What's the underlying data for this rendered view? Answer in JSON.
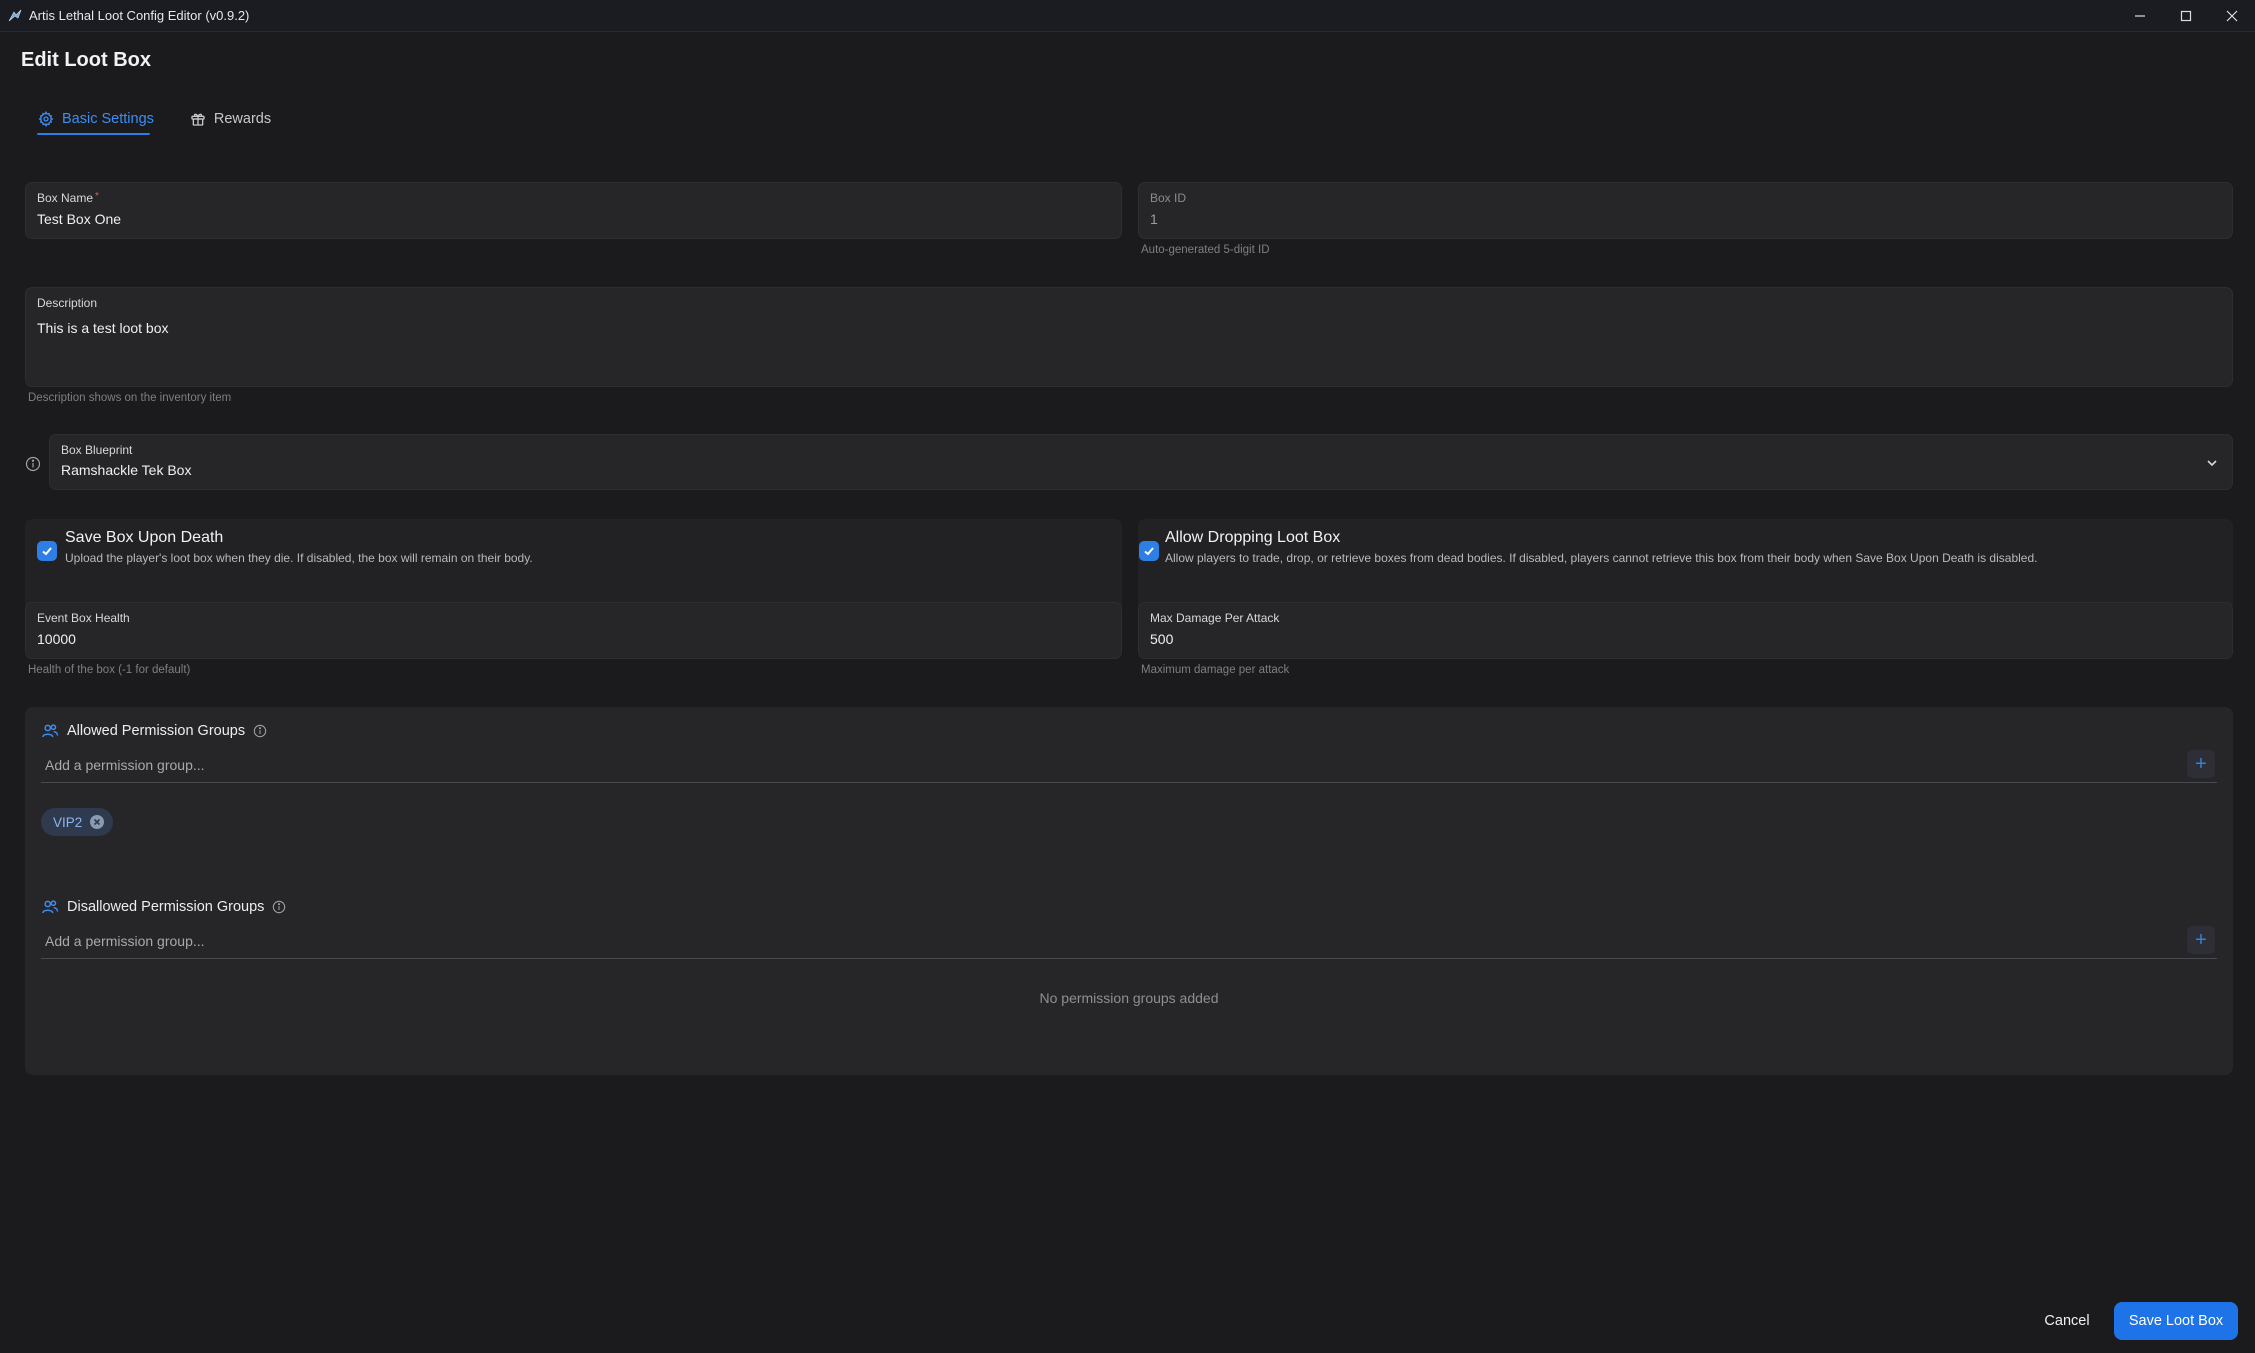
{
  "app": {
    "title": "Artis Lethal Loot Config Editor (v0.9.2)"
  },
  "page": {
    "title": "Edit Loot Box"
  },
  "tabs": [
    {
      "label": "Basic Settings",
      "icon": "gear-icon",
      "active": true
    },
    {
      "label": "Rewards",
      "icon": "gift-icon",
      "active": false
    }
  ],
  "form": {
    "box_name": {
      "label": "Box Name",
      "required_mark": "*",
      "value": "Test Box One"
    },
    "box_id": {
      "label": "Box ID",
      "value": "1",
      "helper": "Auto-generated 5-digit ID"
    },
    "description": {
      "label": "Description",
      "value": "This is a test loot box",
      "helper": "Description shows on the inventory item"
    },
    "blueprint": {
      "label": "Box Blueprint",
      "value": "Ramshackle Tek Box"
    },
    "save_on_death": {
      "checked": true,
      "title": "Save Box Upon Death",
      "desc": "Upload the player's loot box when they die. If disabled, the box will remain on their body."
    },
    "allow_dropping": {
      "checked": true,
      "title": "Allow Dropping Loot Box",
      "desc": "Allow players to trade, drop, or retrieve boxes from dead bodies. If disabled, players cannot retrieve this box from their body when Save Box Upon Death is disabled."
    },
    "event_health": {
      "label": "Event Box Health",
      "value": "10000",
      "helper": "Health of the box (-1 for default)"
    },
    "max_damage": {
      "label": "Max Damage Per Attack",
      "value": "500",
      "helper": "Maximum damage per attack"
    }
  },
  "allowed_groups": {
    "title": "Allowed Permission Groups",
    "placeholder": "Add a permission group...",
    "add_label": "+",
    "chips": [
      "VIP2"
    ]
  },
  "disallowed_groups": {
    "title": "Disallowed Permission Groups",
    "placeholder": "Add a permission group...",
    "add_label": "+",
    "empty": "No permission groups added"
  },
  "footer": {
    "cancel": "Cancel",
    "save": "Save Loot Box"
  },
  "colors": {
    "accent": "#1e73e8",
    "background": "#1b1b1d",
    "card": "#262629"
  }
}
